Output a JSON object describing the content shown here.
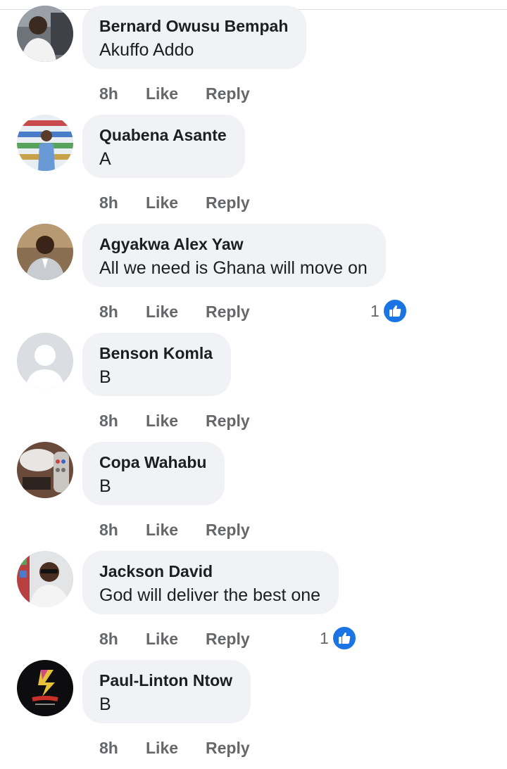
{
  "comments": [
    {
      "author": "Bernard Owusu Bempah",
      "text": "Akuffo  Addo",
      "time": "8h",
      "like_label": "Like",
      "reply_label": "Reply",
      "reactions": null,
      "avatar_icon": "person-in-car-photo"
    },
    {
      "author": "Quabena Asante",
      "text": "A",
      "time": "8h",
      "like_label": "Like",
      "reply_label": "Reply",
      "reactions": null,
      "avatar_icon": "person-in-store-photo"
    },
    {
      "author": "Agyakwa Alex Yaw",
      "text": "All we need is Ghana will move on",
      "time": "8h",
      "like_label": "Like",
      "reply_label": "Reply",
      "reactions": "1",
      "avatar_icon": "man-in-suit-photo"
    },
    {
      "author": "Benson Komla",
      "text": "B",
      "time": "8h",
      "like_label": "Like",
      "reply_label": "Reply",
      "reactions": null,
      "avatar_icon": "default-profile-silhouette"
    },
    {
      "author": "Copa Wahabu",
      "text": "B",
      "time": "8h",
      "like_label": "Like",
      "reply_label": "Reply",
      "reactions": null,
      "avatar_icon": "remote-control-photo"
    },
    {
      "author": "Jackson David",
      "text": "God will deliver the best one",
      "time": "8h",
      "like_label": "Like",
      "reply_label": "Reply",
      "reactions": "1",
      "avatar_icon": "man-with-sunglasses-photo"
    },
    {
      "author": "Paul-Linton Ntow",
      "text": "B",
      "time": "8h",
      "like_label": "Like",
      "reply_label": "Reply",
      "reactions": null,
      "avatar_icon": "linton-logo"
    }
  ],
  "colors": {
    "bubble": "#f0f2f5",
    "author_text": "#1c1e21",
    "meta_text": "#65676b",
    "like_badge": "#1b74e4"
  }
}
